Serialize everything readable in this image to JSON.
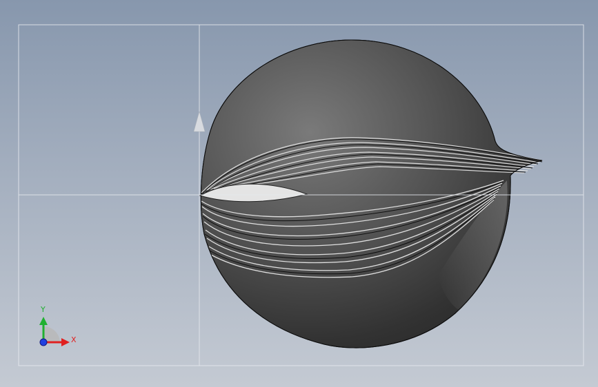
{
  "viewport": {
    "background_top": "#8797ad",
    "background_bottom": "#c4cad3",
    "model_color": "#5a5a5a",
    "sketch_line_color": "#e6e9ee"
  },
  "triad": {
    "x_label": "X",
    "y_label": "Y",
    "x_color": "#e02020",
    "y_color": "#20b030",
    "z_color": "#2040e0"
  },
  "view_indicator": {
    "icon": "up-arrow-icon"
  }
}
